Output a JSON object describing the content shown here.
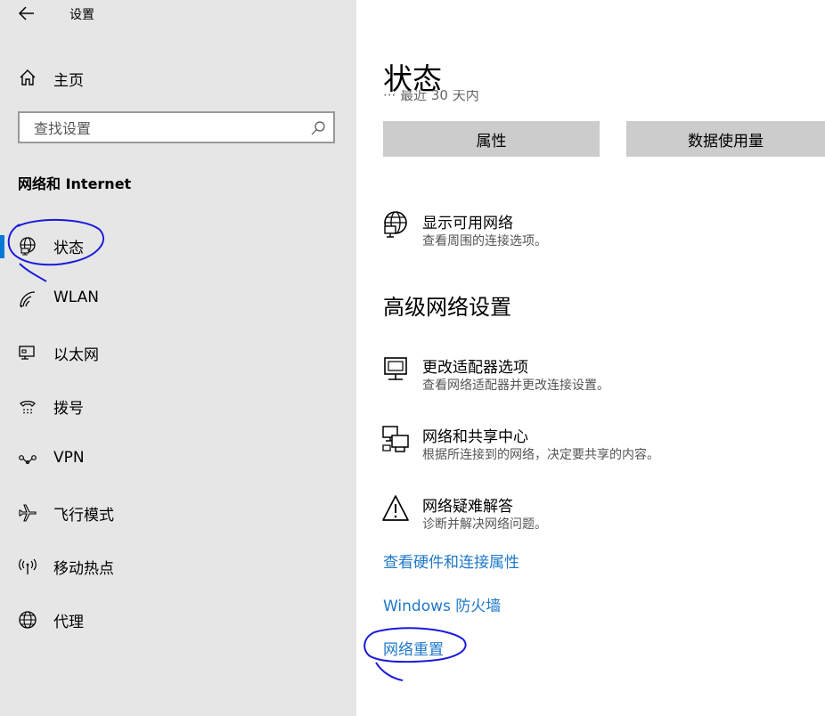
{
  "window": {
    "title": "设置"
  },
  "sidebar": {
    "home_label": "主页",
    "search_placeholder": "查找设置",
    "section_title": "网络和 Internet",
    "items": [
      {
        "label": "状态",
        "icon": "globe-status-icon",
        "selected": true
      },
      {
        "label": "WLAN",
        "icon": "wifi-icon"
      },
      {
        "label": "以太网",
        "icon": "ethernet-icon"
      },
      {
        "label": "拨号",
        "icon": "dialup-icon"
      },
      {
        "label": "VPN",
        "icon": "vpn-icon"
      },
      {
        "label": "飞行模式",
        "icon": "airplane-icon"
      },
      {
        "label": "移动热点",
        "icon": "hotspot-icon"
      },
      {
        "label": "代理",
        "icon": "globe-icon"
      }
    ]
  },
  "main": {
    "title": "状态",
    "clipped_line": "··· 最近 30 天内",
    "buttons": {
      "properties": "属性",
      "data_usage": "数据使用量"
    },
    "show_networks": {
      "title": "显示可用网络",
      "desc": "查看周围的连接选项。"
    },
    "advanced_heading": "高级网络设置",
    "advanced": [
      {
        "title": "更改适配器选项",
        "desc": "查看网络适配器并更改连接设置。",
        "icon": "adapter-icon"
      },
      {
        "title": "网络和共享中心",
        "desc": "根据所连接到的网络，决定要共享的内容。",
        "icon": "sharing-center-icon"
      },
      {
        "title": "网络疑难解答",
        "desc": "诊断并解决网络问题。",
        "icon": "warning-icon"
      }
    ],
    "links": {
      "hardware": "查看硬件和连接属性",
      "firewall": "Windows 防火墙",
      "reset": "网络重置"
    }
  },
  "colors": {
    "accent": "#0078d7",
    "link": "#1f78c8",
    "annotation": "#1a1adc"
  }
}
